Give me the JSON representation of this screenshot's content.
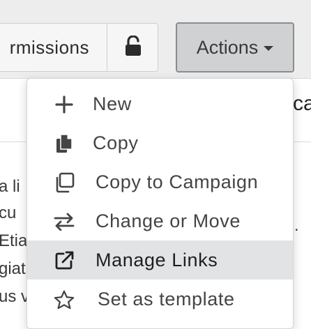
{
  "toolbar": {
    "permissions_label": "rmissions",
    "lock_icon": "unlock-icon",
    "actions_label": "Actions"
  },
  "background": {
    "right_heading_fragment": "ca",
    "left_lines": [
      "a li",
      "cu",
      "Etia",
      "giat",
      "us v"
    ],
    "right_dot": "."
  },
  "menu": {
    "items": [
      {
        "label": "New",
        "icon": "plus-icon"
      },
      {
        "label": "Copy",
        "icon": "copy-icon"
      },
      {
        "label": "Copy to Campaign",
        "icon": "copy-to-campaign-icon"
      },
      {
        "label": "Change or Move",
        "icon": "arrows-exchange-icon"
      },
      {
        "label": "Manage Links",
        "icon": "external-link-icon"
      },
      {
        "label": "Set as template",
        "icon": "star-icon"
      }
    ],
    "active_index": 4
  },
  "colors": {
    "toolbar_bg": "#ededed",
    "actions_bg": "#cfd1d3",
    "active_item_bg": "#e2e3e5"
  }
}
